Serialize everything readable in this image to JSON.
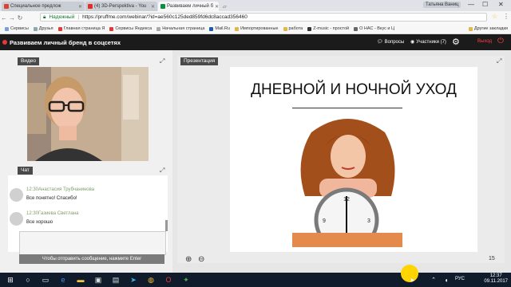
{
  "browser": {
    "tabs": [
      {
        "label": "Специальное предлож",
        "fav": "#e0402f"
      },
      {
        "label": "(4) 3D-Perspektiva - You",
        "fav": "#e52d27"
      },
      {
        "label": "Развиваем личный б",
        "fav": "#0b8f3e",
        "active": true
      }
    ],
    "window_user": "Татьяна Ваниц",
    "address": {
      "secure_label": "Надежный",
      "url": "https://pruffme.com/webinar/?id=ae560c125ded859fd6dc8accad356460"
    },
    "bookmarks": [
      "Сервисы",
      "Друзья",
      "Главная страница Я",
      "Сервисы Яндекса",
      "Начальная страница",
      "Mail.Ru",
      "Импортированные",
      "работа",
      "Z-music - простой",
      "О НАС - Вкус и Ц",
      "Другие закладки"
    ]
  },
  "webinar": {
    "title": "Развиваем личный бренд в соцсетях",
    "questions_label": "Вопросы",
    "participants_label": "Участники (7)",
    "exit_label": "Выход"
  },
  "video": {
    "label": "Видео"
  },
  "chat": {
    "label": "Чат",
    "messages": [
      {
        "time": "12:30",
        "author": "Анастасия Трубчанинова",
        "text": "Все понятно! Спасибо!"
      },
      {
        "time": "12:30",
        "author": "Газиева Светлана",
        "text": "Все хорошо"
      }
    ],
    "send_hint": "Чтобы отправить сообщение, нажмите Enter"
  },
  "presentation": {
    "label": "Презентация",
    "slide_title": "ДНЕВНОЙ И НОЧНОЙ УХОД",
    "page": "15"
  },
  "taskbar": {
    "language": "РУС",
    "time": "12:37",
    "date": "09.11.2017"
  }
}
